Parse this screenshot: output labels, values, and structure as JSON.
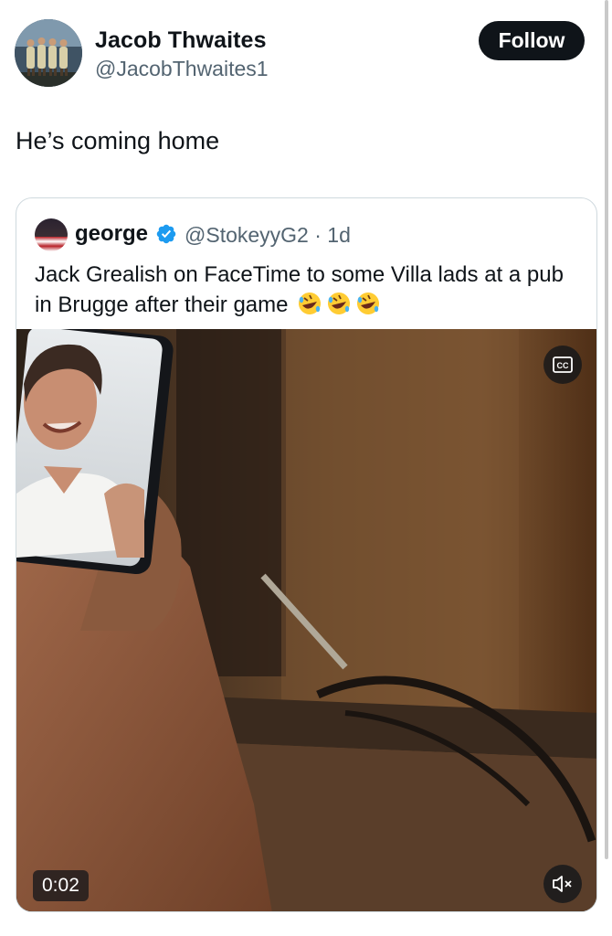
{
  "post": {
    "author_name": "Jacob Thwaites",
    "author_handle": "@JacobThwaites1",
    "follow_label": "Follow",
    "text": "He’s coming home"
  },
  "quoted": {
    "name": "george",
    "handle_time": "@StokeyyG2 · 1d",
    "text": "Jack Grealish on FaceTime to some Villa lads at a pub in Brugge after their game"
  },
  "video": {
    "timestamp": "0:02",
    "cc_icon": "closed-captions-icon",
    "mute_icon": "volume-muted-icon"
  },
  "icons": {
    "verified": "verified-badge-icon",
    "emoji": "rolling-on-the-floor-laughing-emoji"
  },
  "colors": {
    "text": "#0f1419",
    "secondary": "#536471",
    "verified_blue": "#1d9bf0",
    "follow_bg": "#0f1419",
    "border": "#cfd9de"
  }
}
